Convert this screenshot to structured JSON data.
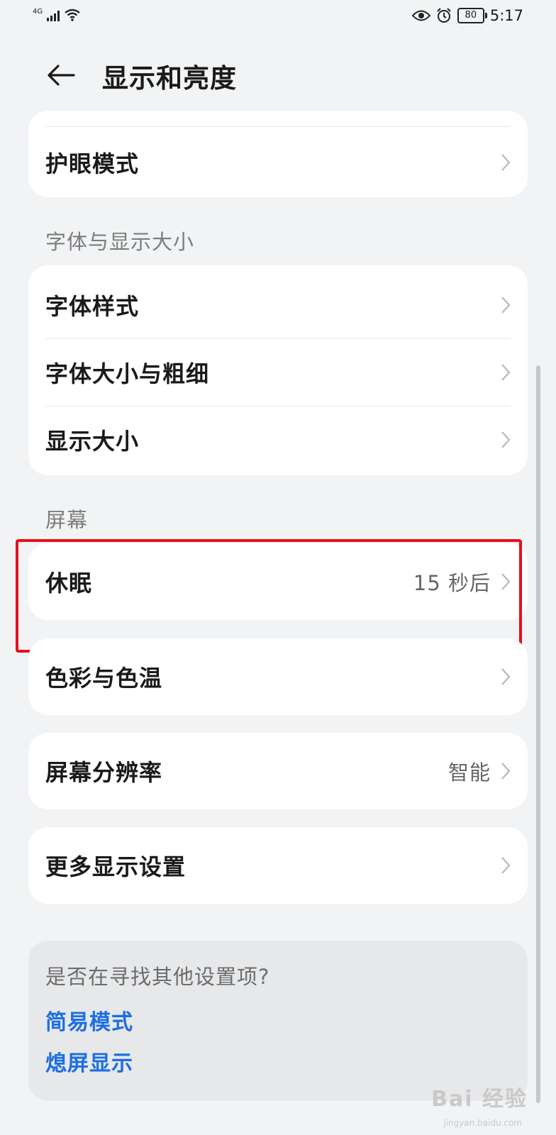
{
  "status_bar": {
    "network": "4G",
    "time": "5:17",
    "battery": "80",
    "icons": [
      "signal-icon",
      "wifi-icon",
      "eye-icon",
      "alarm-icon",
      "battery-icon"
    ]
  },
  "header": {
    "title": "显示和亮度",
    "back_icon": "arrow-left-icon"
  },
  "eye_comfort": {
    "label": "护眼模式"
  },
  "font_section": {
    "title": "字体与显示大小",
    "items": [
      {
        "label": "字体样式"
      },
      {
        "label": "字体大小与粗细"
      },
      {
        "label": "显示大小"
      }
    ]
  },
  "screen_section": {
    "title": "屏幕",
    "sleep": {
      "label": "休眠",
      "value": "15 秒后"
    },
    "color": {
      "label": "色彩与色温"
    },
    "resolution": {
      "label": "屏幕分辨率",
      "value": "智能"
    },
    "more": {
      "label": "更多显示设置"
    }
  },
  "footer": {
    "question": "是否在寻找其他设置项?",
    "links": [
      "简易模式",
      "熄屏显示"
    ]
  },
  "watermark": {
    "text": "Bai 经验",
    "sub": "jingyan.baidu.com"
  },
  "colors": {
    "link": "#1d6ee0",
    "highlight": "#e80f1c",
    "background": "#f1f3f5"
  }
}
